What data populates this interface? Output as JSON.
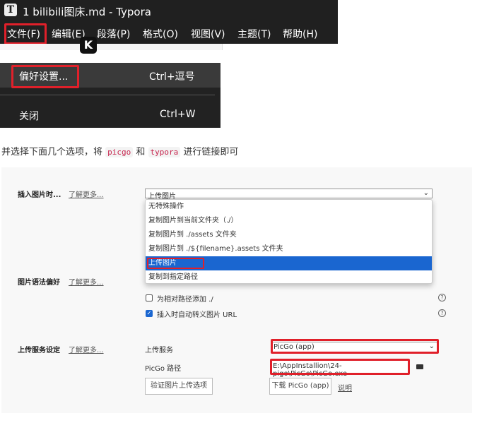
{
  "window": {
    "title": "1 bilibili图床.md - Typora",
    "app_icon": "T"
  },
  "menubar": [
    "文件(F)",
    "编辑(E)",
    "段落(P)",
    "格式(O)",
    "视图(V)",
    "主题(T)",
    "帮助(H)"
  ],
  "badge": "K",
  "file_menu": [
    {
      "label": "偏好设置...",
      "shortcut": "Ctrl+逗号"
    },
    {
      "label": "关闭",
      "shortcut": "Ctrl+W"
    }
  ],
  "instruction": {
    "pre": "并选择下面几个选项，将 ",
    "code1": "picgo",
    "mid": " 和 ",
    "code2": "typora",
    "post": " 进行链接即可"
  },
  "settings": {
    "insert_image": {
      "label": "插入图片时...",
      "more": "了解更多...",
      "selected": "上传图片",
      "options": [
        "无特殊操作",
        "复制图片到当前文件夹（./）",
        "复制图片到 ./assets 文件夹",
        "复制图片到 ./${filename}.assets 文件夹",
        "上传图片",
        "复制到指定路径"
      ]
    },
    "syntax": {
      "label": "图片语法偏好",
      "more": "了解更多...",
      "checkboxes": [
        {
          "label": "为相对路径添加 ./",
          "checked": false
        },
        {
          "label": "插入时自动转义图片 URL",
          "checked": true
        }
      ]
    },
    "upload": {
      "label": "上传服务设定",
      "more": "了解更多...",
      "service_label": "上传服务",
      "service_value": "PicGo (app)",
      "path_label": "PicGo 路径",
      "path_value": "E:\\AppInstallion\\24-pigo\\PicGo\\PicGo.exe",
      "verify_button": "验证图片上传选项",
      "download_button": "下载 PicGo (app)",
      "help_link": "说明"
    }
  },
  "colors": {
    "highlight": "#1a66d0",
    "redbox": "#e0202a",
    "dark": "#202020"
  }
}
